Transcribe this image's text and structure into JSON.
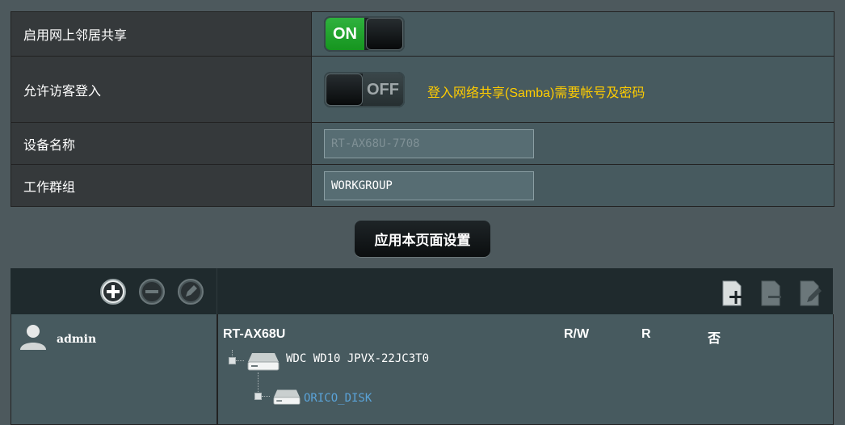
{
  "settings": {
    "network_share": {
      "label": "启用网上邻居共享",
      "toggle": "ON"
    },
    "guest_login": {
      "label": "允许访客登入",
      "toggle": "OFF",
      "hint": "登入网络共享(Samba)需要帐号及密码"
    },
    "device_name": {
      "label": "设备名称",
      "value": "RT-AX68U-7708"
    },
    "workgroup": {
      "label": "工作群组",
      "value": "WORKGROUP"
    }
  },
  "apply_button": "应用本页面设置",
  "users": {
    "toolbar_icons": [
      "add-user-icon",
      "remove-user-icon",
      "edit-user-icon"
    ],
    "items": [
      {
        "name": "admin"
      }
    ]
  },
  "folders": {
    "toolbar_icons": [
      "add-folder-icon",
      "remove-folder-icon",
      "edit-folder-icon"
    ],
    "root": "RT-AX68U",
    "permission_headers": [
      "R/W",
      "R",
      "否"
    ],
    "drives": [
      {
        "label": "WDC WD10 JPVX-22JC3T0"
      },
      {
        "label": "ORICO_DISK"
      }
    ]
  },
  "colors": {
    "accent_on": "#1fa42e",
    "hint": "#ffcc00",
    "link": "#5aa3d8"
  }
}
